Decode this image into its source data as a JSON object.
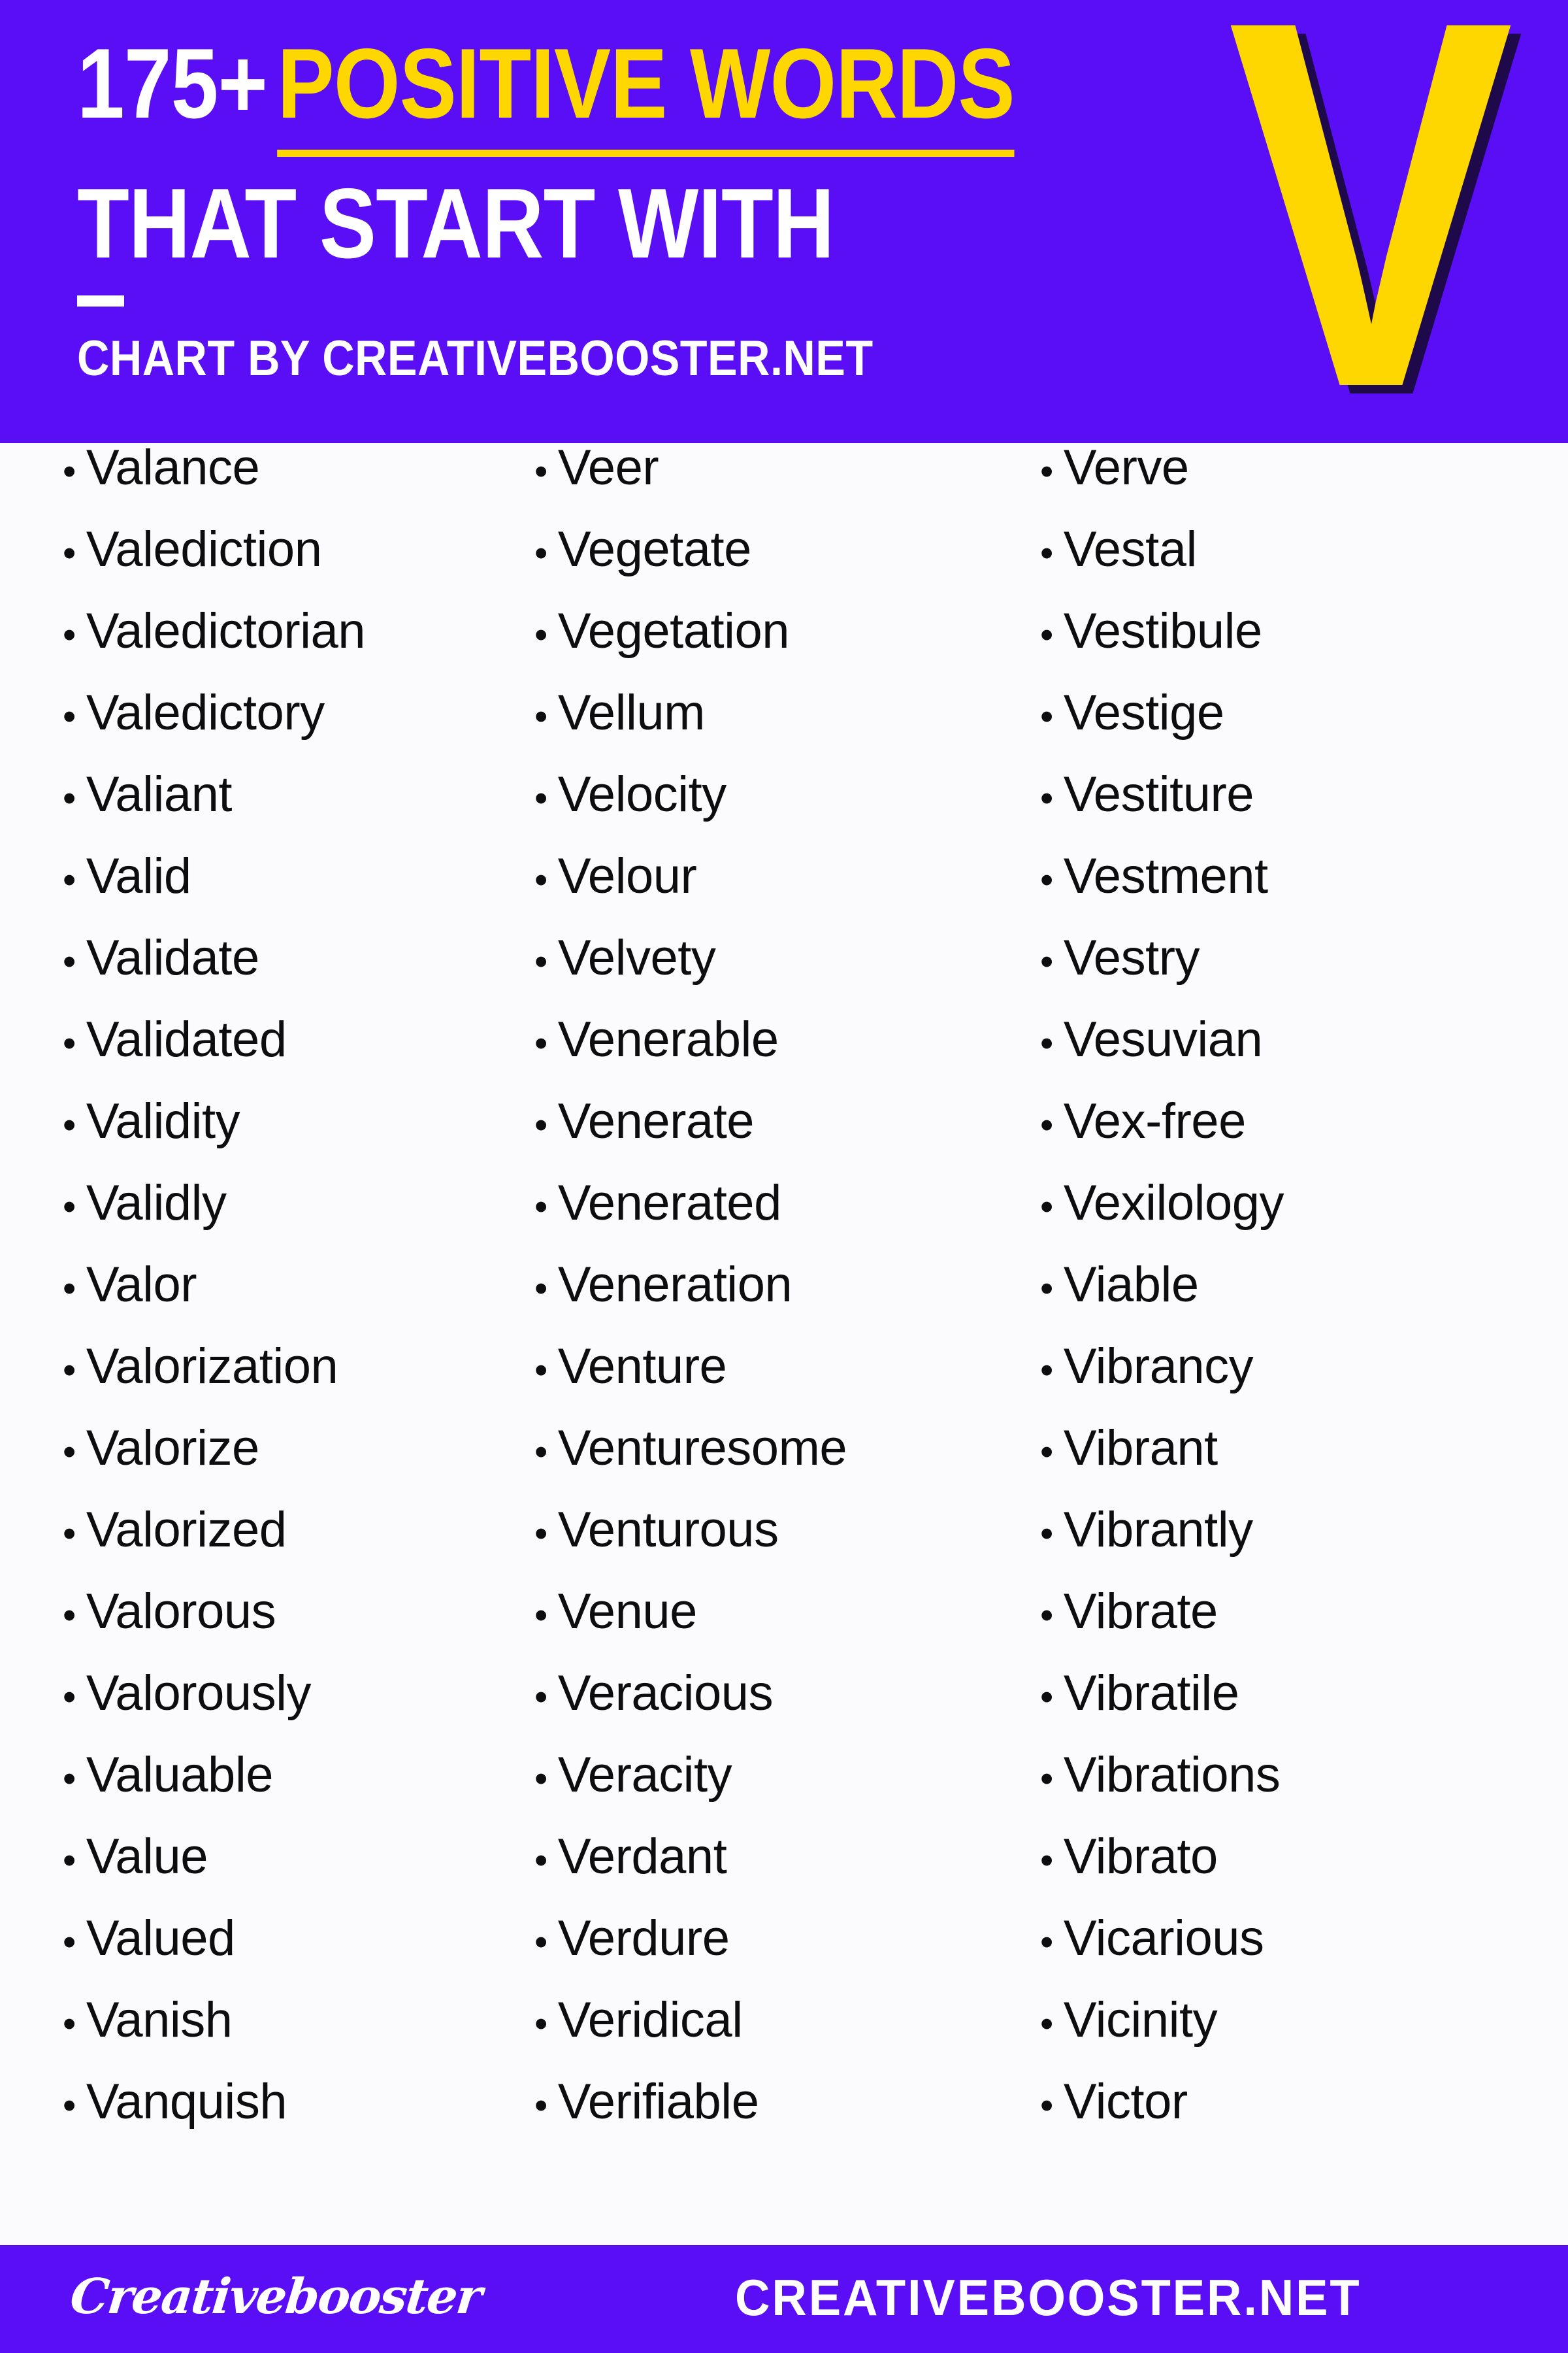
{
  "header": {
    "count_text": "175+",
    "highlight_text": "POSITIVE WORDS",
    "line2_text": "THAT START WITH",
    "byline": "CHART BY CREATIVEBOOSTER.NET",
    "big_letter": "V",
    "colors": {
      "background": "#5A0EF5",
      "highlight": "#FFD700",
      "letter": "#FFD700",
      "letter_shadow": "#1E0A4B",
      "text": "#FFFFFF"
    }
  },
  "list": {
    "bullet": "•",
    "columns": [
      {
        "words": [
          "Valance",
          "Valediction",
          "Valedictorian",
          "Valedictory",
          "Valiant",
          "Valid",
          "Validate",
          "Validated",
          "Validity",
          "Validly",
          "Valor",
          "Valorization",
          "Valorize",
          "Valorized",
          "Valorous",
          "Valorously",
          "Valuable",
          "Value",
          "Valued",
          "Vanish",
          "Vanquish"
        ]
      },
      {
        "words": [
          "Veer",
          "Vegetate",
          "Vegetation",
          "Vellum",
          "Velocity",
          "Velour",
          "Velvety",
          "Venerable",
          "Venerate",
          "Venerated",
          "Veneration",
          "Venture",
          "Venturesome",
          "Venturous",
          "Venue",
          "Veracious",
          "Veracity",
          "Verdant",
          "Verdure",
          "Veridical",
          "Verifiable"
        ]
      },
      {
        "words": [
          "Verve",
          "Vestal",
          "Vestibule",
          "Vestige",
          "Vestiture",
          "Vestment",
          "Vestry",
          "Vesuvian",
          "Vex-free",
          "Vexilology",
          "Viable",
          "Vibrancy",
          "Vibrant",
          "Vibrantly",
          "Vibrate",
          "Vibratile",
          "Vibrations",
          "Vibrato",
          "Vicarious",
          "Vicinity",
          "Victor"
        ]
      }
    ]
  },
  "footer": {
    "logo_text": "Creativebooster",
    "site_text": "CREATIVEBOOSTER.NET",
    "background": "#5A0EF5"
  }
}
